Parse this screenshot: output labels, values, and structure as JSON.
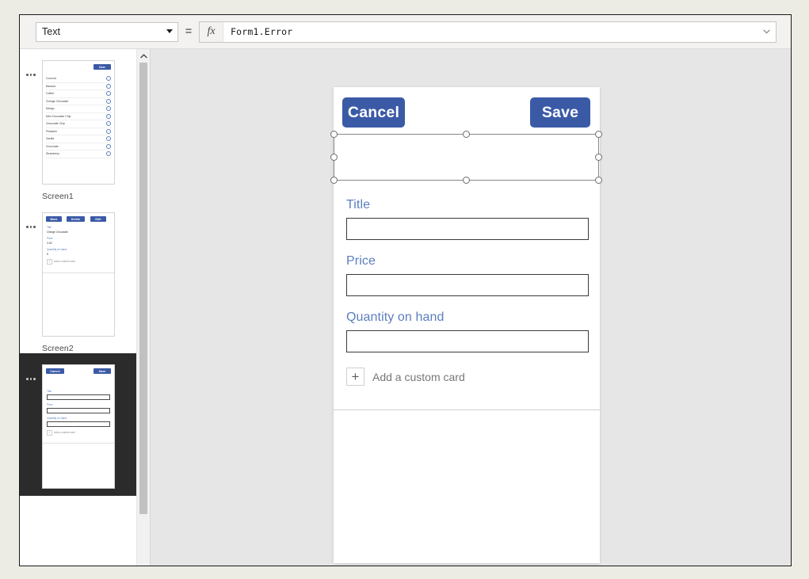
{
  "formula_bar": {
    "property_selected": "Text",
    "property_options": [
      "Text"
    ],
    "equals": "=",
    "fx_label": "fx",
    "formula_value": "Form1.Error",
    "expand_icon": "chevron-down-icon"
  },
  "screens_panel": {
    "scroll_up_icon": "chevron-up-icon",
    "screens": [
      {
        "label": "Screen1",
        "selected": false,
        "type": "gallery",
        "new_button": "New",
        "items": [
          "Coconut",
          "Banana",
          "Coffee",
          "Orange Chocolate",
          "Mango",
          "Mint Chocolate Chip",
          "Chocolate Chip",
          "Pistachio",
          "Vanilla",
          "Chocolate",
          "Strawberry"
        ],
        "item_chevron": "chevron-right-icon"
      },
      {
        "label": "Screen2",
        "selected": false,
        "type": "detail",
        "buttons": [
          "Back",
          "Delete",
          "Edit"
        ],
        "fields": [
          {
            "label": "Title",
            "value": "Orange Chocolate"
          },
          {
            "label": "Price",
            "value": "3.45"
          },
          {
            "label": "Quantity on hand",
            "value": "5"
          }
        ],
        "add_card_label": "Add a custom card"
      },
      {
        "label": "",
        "selected": true,
        "type": "edit",
        "buttons": [
          "Cancel",
          "Save"
        ],
        "fields": [
          {
            "label": "Title",
            "value": ""
          },
          {
            "label": "Price",
            "value": ""
          },
          {
            "label": "Quantity on hand",
            "value": ""
          }
        ],
        "add_card_label": "Add a custom card"
      }
    ]
  },
  "canvas": {
    "cancel_button": "Cancel",
    "save_button": "Save",
    "selected_control_handles": 8,
    "fields": [
      {
        "label": "Title",
        "value": "",
        "placeholder": ""
      },
      {
        "label": "Price",
        "value": "",
        "placeholder": ""
      },
      {
        "label": "Quantity on hand",
        "value": "",
        "placeholder": ""
      }
    ],
    "add_custom_card": {
      "plus_icon": "plus-icon",
      "label": "Add a custom card"
    }
  },
  "colors": {
    "accent_blue": "#3b5aa6",
    "label_blue": "#5b7ebd",
    "canvas_bg": "#e6e6e6",
    "page_bg": "#edece4",
    "selected_screen_bg": "#2b2b2b"
  }
}
